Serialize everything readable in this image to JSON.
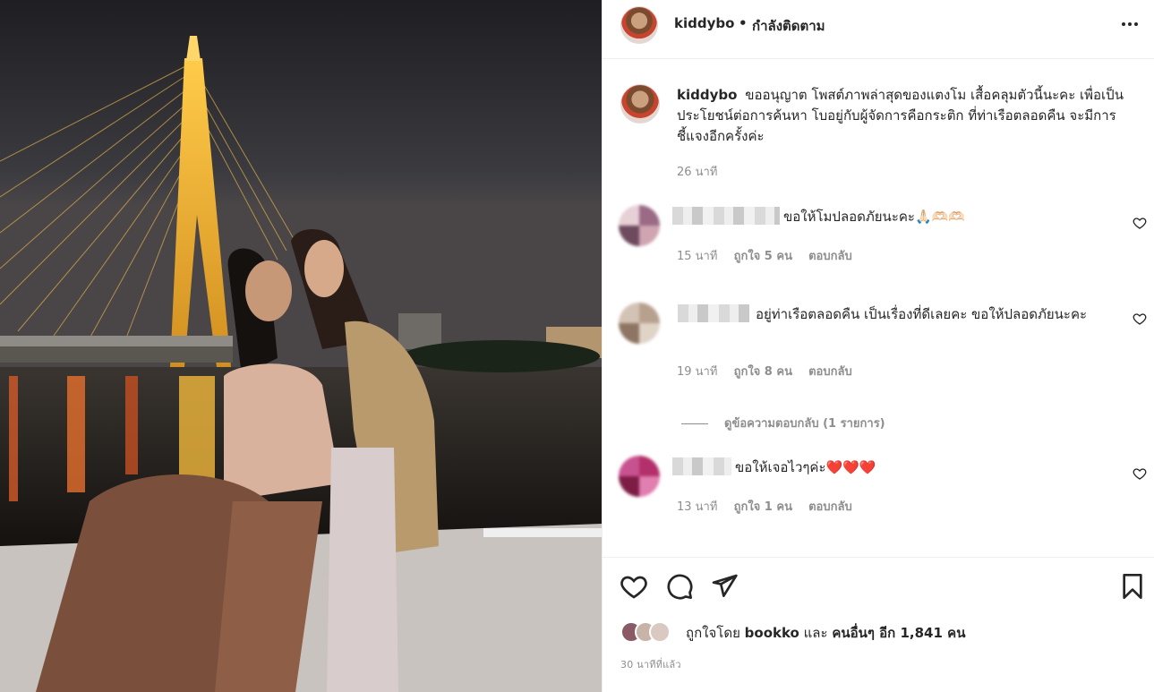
{
  "post": {
    "username": "kiddybo",
    "dot": "•",
    "follow_status": "กำลังติดตาม",
    "more_label": "•••"
  },
  "caption": {
    "username": "kiddybo",
    "text": "ขออนุญาต โพสต์ภาพล่าสุดของแตงโม เสื้อคลุมตัวนี้นะคะ เพื่อเป็นประโยชน์ต่อการค้นหา โบอยู่กับผู้จัดการคือกระติก ที่ท่าเรือตลอดคืน จะมีการชี้แจงอีกครั้งค่ะ",
    "time": "26 นาที"
  },
  "comments": [
    {
      "text": "ขอให้โมปลอดภัยนะคะ🙏🏻🫶🏻🫶🏻",
      "time": "15 นาที",
      "likes": "ถูกใจ 5 คน",
      "reply": "ตอบกลับ"
    },
    {
      "text": "อยู่ท่าเรือตลอดคืน เป็นเรื่องที่ดีเลยคะ ขอให้ปลอดภัยนะคะ",
      "time": "19 นาที",
      "likes": "ถูกใจ 8 คน",
      "reply": "ตอบกลับ"
    },
    {
      "text": "ขอให้เจอไวๆค่ะ❤️❤️❤️",
      "time": "13 นาที",
      "likes": "ถูกใจ 1 คน",
      "reply": "ตอบกลับ"
    }
  ],
  "view_replies": "ดูข้อความตอบกลับ (1 รายการ)",
  "likes": {
    "prefix": "ถูกใจโดย",
    "user": "bookko",
    "and": "และ",
    "others": "คนอื่นๆ อีก 1,841 คน"
  },
  "post_time": "30 นาทีที่แล้ว",
  "icons": [
    "heart-icon",
    "comment-icon",
    "share-icon",
    "bookmark-icon",
    "more-icon"
  ]
}
